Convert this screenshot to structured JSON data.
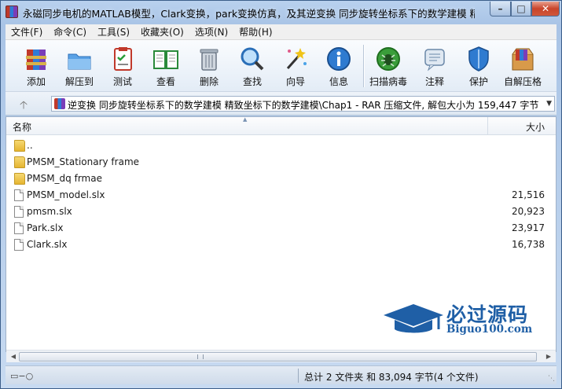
{
  "window": {
    "title": "永磁同步电机的MATLAB模型，Clark变换，park变换仿真，及其逆变换 同步旋转坐标系下的数学建模 精..."
  },
  "menu": [
    {
      "label": "文件(F)"
    },
    {
      "label": "命令(C)"
    },
    {
      "label": "工具(S)"
    },
    {
      "label": "收藏夹(O)"
    },
    {
      "label": "选项(N)"
    },
    {
      "label": "帮助(H)"
    }
  ],
  "toolbar": [
    {
      "label": "添加",
      "icon": "add-archive-icon"
    },
    {
      "label": "解压到",
      "icon": "extract-to-icon"
    },
    {
      "label": "测试",
      "icon": "test-icon"
    },
    {
      "label": "查看",
      "icon": "view-book-icon"
    },
    {
      "label": "删除",
      "icon": "trash-icon"
    },
    {
      "label": "查找",
      "icon": "magnifier-icon"
    },
    {
      "label": "向导",
      "icon": "wizard-wand-icon"
    },
    {
      "label": "信息",
      "icon": "info-icon"
    },
    {
      "label": "扫描病毒",
      "icon": "virus-scan-icon"
    },
    {
      "label": "注释",
      "icon": "comment-icon"
    },
    {
      "label": "保护",
      "icon": "shield-icon"
    },
    {
      "label": "自解压格",
      "icon": "sfx-box-icon"
    }
  ],
  "address": {
    "path": "逆变换 同步旋转坐标系下的数学建模 精致坐标下的数学建模\\Chap1 - RAR 压缩文件, 解包大小为 159,447 字节"
  },
  "columns": {
    "name": "名称",
    "size": "大小"
  },
  "files": [
    {
      "name": "..",
      "size": "",
      "type": "folder"
    },
    {
      "name": "PMSM_Stationary frame",
      "size": "",
      "type": "folder"
    },
    {
      "name": "PMSM_dq frmae",
      "size": "",
      "type": "folder"
    },
    {
      "name": "PMSM_model.slx",
      "size": "21,516",
      "type": "file"
    },
    {
      "name": "pmsm.slx",
      "size": "20,923",
      "type": "file"
    },
    {
      "name": "Park.slx",
      "size": "23,917",
      "type": "file"
    },
    {
      "name": "Clark.slx",
      "size": "16,738",
      "type": "file"
    }
  ],
  "watermark": {
    "title": "必过源码",
    "url": "Biguo100.com"
  },
  "status": {
    "summary": "总计 2 文件夹 和 83,094 字节(4 个文件)"
  },
  "colors": {
    "accent": "#1f5fa6",
    "folder": "#e5b531",
    "close": "#c8442a"
  }
}
